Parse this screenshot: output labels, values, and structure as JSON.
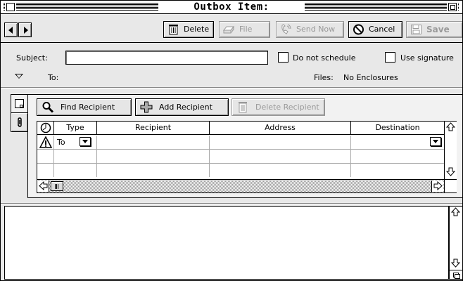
{
  "window": {
    "title": "Outbox Item:"
  },
  "toolbar": {
    "delete_label": "Delete",
    "file_label": "File",
    "sendnow_label": "Send Now",
    "cancel_label": "Cancel",
    "save_label": "Save"
  },
  "header": {
    "subject_label": "Subject:",
    "subject_value": "",
    "do_not_schedule_label": "Do not schedule",
    "do_not_schedule_checked": false,
    "use_signature_label": "Use signature",
    "use_signature_checked": false,
    "to_label": "To:",
    "files_label": "Files:",
    "files_value": "No Enclosures"
  },
  "recipients_panel": {
    "find_label": "Find Recipient",
    "add_label": "Add Recipient",
    "delete_label": "Delete Recipient",
    "columns": [
      "Type",
      "Recipient",
      "Address",
      "Destination"
    ],
    "rows": [
      {
        "type": "To",
        "recipient": "",
        "address": "",
        "destination": ""
      }
    ]
  },
  "icons": {
    "close": "close-box-icon",
    "zoom": "zoom-box-icon",
    "delete": "trash-icon",
    "file": "file-tray-icon",
    "sendnow": "send-now-icon",
    "cancel": "cancel-icon",
    "save": "save-disk-icon",
    "find": "magnifier-icon",
    "add": "plus-icon",
    "warning": "warning-triangle-icon",
    "clock": "clock-icon"
  },
  "colors": {
    "disabled_text": "#999999",
    "window_bg": "#e8e8e8"
  }
}
